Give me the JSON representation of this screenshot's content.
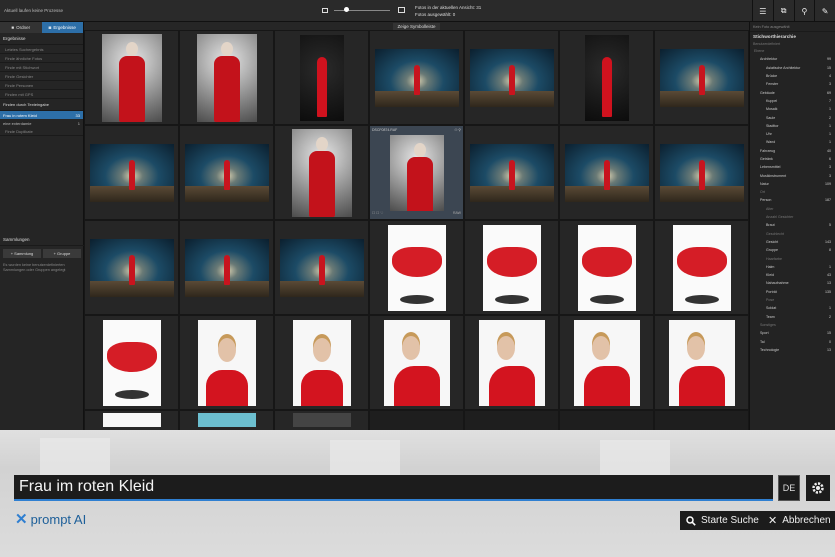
{
  "topbar": {
    "title": "Aktuell laufen keine Prozesse",
    "info_line1": "Fotos in der aktuellen Ansicht: 31",
    "info_line2": "Fotos ausgewählt: 0",
    "zoom_level": 0.18
  },
  "left": {
    "tabs": [
      {
        "label": "Ordner",
        "icon": "folder-icon"
      },
      {
        "label": "Ergebnisse",
        "icon": "camera-icon",
        "active": true
      }
    ],
    "results_header": "Ergebnisse",
    "items": [
      "Letztes Suchergebnis",
      "Finde ähnliche Fotos",
      "Finde mit Stichwort",
      "Finde Gesichter",
      "Finde Personen",
      "Finden mit GPS"
    ],
    "text_search_header": "Finden durch Texteingabe",
    "text_searches": [
      {
        "label": "Frau in rotem Kleid",
        "count": "33",
        "selected": true
      },
      {
        "label": "eine exterdamie",
        "count": "1",
        "selected": false
      }
    ],
    "duplicates": "Finde Duplikate",
    "collections": {
      "header": "Sammlungen",
      "btn_collection": "Sammlung",
      "btn_group": "Gruppe",
      "note": "Es wurden keine benutzerdefinierten Sammlungen oder Gruppen angelegt"
    }
  },
  "grid": {
    "header_label": "Zeige Symbolleiste",
    "focus_cell": {
      "name": "DSCF0874.RAF",
      "size": "RAW"
    },
    "cells": [
      "grey",
      "grey",
      "dark",
      "tunnel",
      "tunnel",
      "dark",
      "tunnel",
      "tunnel",
      "tunnel",
      "grey",
      "focus",
      "tunnel",
      "tunnel",
      "tunnel",
      "tunnel",
      "tunnel",
      "tunnel",
      "white",
      "white",
      "white",
      "white",
      "white",
      "portrait",
      "portrait",
      "pose",
      "pose",
      "pose",
      "pose",
      "partial",
      "partialb",
      "partialc",
      "empty",
      "empty",
      "empty",
      "empty"
    ]
  },
  "right": {
    "header": "Kein Foto ausgewählt",
    "title": "Stichworthierarchie",
    "subtitle": "Benutzerdefiniert",
    "rows": [
      {
        "label": "Ebene",
        "count": "",
        "indent": 0,
        "dim": true
      },
      {
        "label": "Architektur",
        "count": "99",
        "indent": 1,
        "dim": false
      },
      {
        "label": "Asiatische Architektur",
        "count": "15",
        "indent": 2,
        "dim": false
      },
      {
        "label": "Brücke",
        "count": "4",
        "indent": 2,
        "dim": false
      },
      {
        "label": "Fenster",
        "count": "3",
        "indent": 2,
        "dim": false
      },
      {
        "label": "Gebäude",
        "count": "69",
        "indent": 1,
        "dim": false
      },
      {
        "label": "Kuppel",
        "count": "7",
        "indent": 2,
        "dim": false
      },
      {
        "label": "Mosaik",
        "count": "1",
        "indent": 2,
        "dim": false
      },
      {
        "label": "Saule",
        "count": "2",
        "indent": 2,
        "dim": false
      },
      {
        "label": "Stadttor",
        "count": "1",
        "indent": 2,
        "dim": false
      },
      {
        "label": "Uhr",
        "count": "1",
        "indent": 2,
        "dim": false
      },
      {
        "label": "Wand",
        "count": "1",
        "indent": 2,
        "dim": false
      },
      {
        "label": "Fahrzeug",
        "count": "40",
        "indent": 1,
        "dim": false
      },
      {
        "label": "Getränk",
        "count": "6",
        "indent": 1,
        "dim": false
      },
      {
        "label": "Lebensmittel",
        "count": "3",
        "indent": 1,
        "dim": false
      },
      {
        "label": "Musikinstrument",
        "count": "3",
        "indent": 1,
        "dim": false
      },
      {
        "label": "Natur",
        "count": "109",
        "indent": 1,
        "dim": false
      },
      {
        "label": "Ort",
        "count": "",
        "indent": 1,
        "dim": true
      },
      {
        "label": "Person",
        "count": "187",
        "indent": 1,
        "dim": false
      },
      {
        "label": "Alter",
        "count": "",
        "indent": 2,
        "dim": true
      },
      {
        "label": "Anzahl Gesichter",
        "count": "",
        "indent": 2,
        "dim": true
      },
      {
        "label": "Braut",
        "count": "5",
        "indent": 2,
        "dim": false
      },
      {
        "label": "Geschlecht",
        "count": "",
        "indent": 2,
        "dim": true
      },
      {
        "label": "Gesicht",
        "count": "143",
        "indent": 2,
        "dim": false
      },
      {
        "label": "Gruppe",
        "count": "8",
        "indent": 2,
        "dim": false
      },
      {
        "label": "Haarfarbe",
        "count": "",
        "indent": 2,
        "dim": true
      },
      {
        "label": "Halm",
        "count": "1",
        "indent": 2,
        "dim": false
      },
      {
        "label": "Kleid",
        "count": "43",
        "indent": 2,
        "dim": false
      },
      {
        "label": "Nahaufnahme",
        "count": "13",
        "indent": 2,
        "dim": false
      },
      {
        "label": "Porträt",
        "count": "135",
        "indent": 2,
        "dim": false
      },
      {
        "label": "Pose",
        "count": "",
        "indent": 2,
        "dim": true
      },
      {
        "label": "Soldat",
        "count": "1",
        "indent": 2,
        "dim": false
      },
      {
        "label": "Team",
        "count": "2",
        "indent": 2,
        "dim": false
      },
      {
        "label": "Sonstiges",
        "count": "",
        "indent": 1,
        "dim": true
      },
      {
        "label": "Sport",
        "count": "15",
        "indent": 1,
        "dim": false
      },
      {
        "label": "Tal",
        "count": "0",
        "indent": 1,
        "dim": false
      },
      {
        "label": "Technologie",
        "count": "13",
        "indent": 1,
        "dim": false
      }
    ]
  },
  "search": {
    "value": "Frau im roten Kleid",
    "language": "DE",
    "brand": "prompt AI",
    "start_label": "Starte Suche",
    "cancel_label": "Abbrechen",
    "accent": "#2f7fd1"
  }
}
